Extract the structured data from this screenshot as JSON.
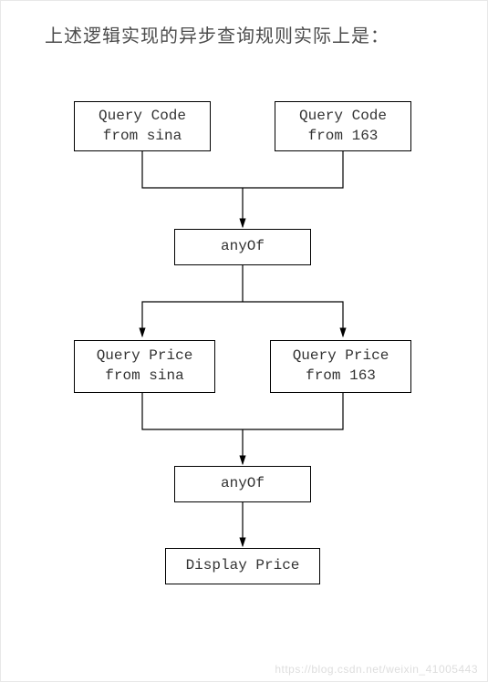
{
  "title": "上述逻辑实现的异步查询规则实际上是：",
  "boxes": {
    "qc_sina": "Query Code\nfrom sina",
    "qc_163": "Query Code\nfrom 163",
    "anyof1": "anyOf",
    "qp_sina": "Query Price\nfrom sina",
    "qp_163": "Query Price\nfrom 163",
    "anyof2": "anyOf",
    "display": "Display Price"
  },
  "watermark": "https://blog.csdn.net/weixin_41005443"
}
